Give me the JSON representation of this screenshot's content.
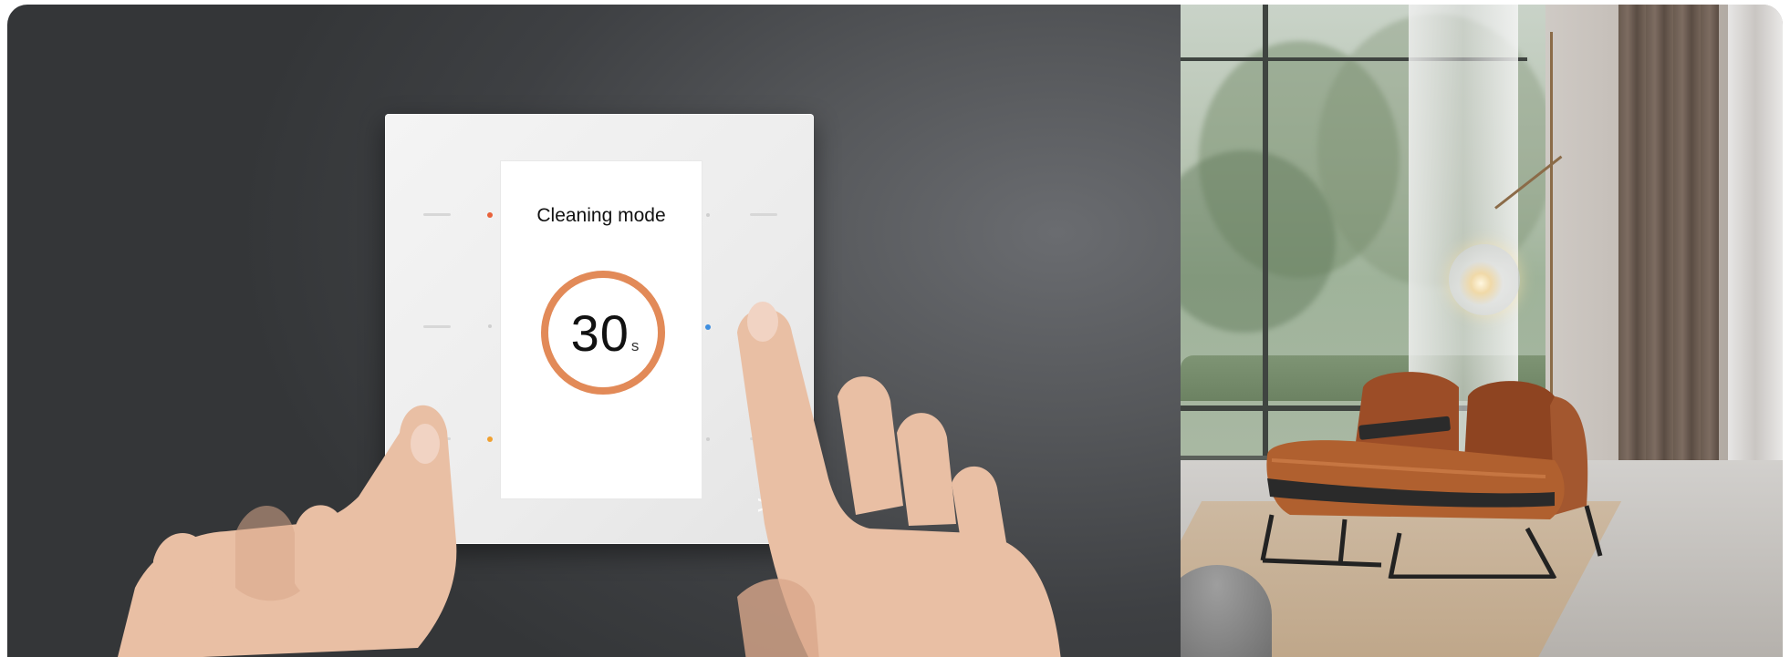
{
  "panel": {
    "screen_title": "Cleaning mode",
    "countdown_value": "30",
    "countdown_unit": "s",
    "next_glyph": ">",
    "led_colors": {
      "top_left": "#e8623a",
      "middle_right": "#3f8fe0",
      "bottom_left": "#f0a030"
    },
    "ring_color": "#e28a58"
  }
}
